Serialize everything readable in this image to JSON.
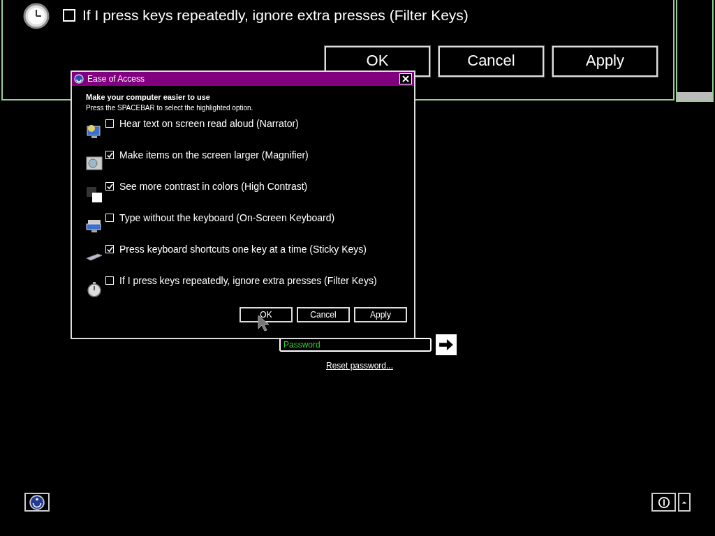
{
  "background_window": {
    "checkbox_label": "If I press keys repeatedly, ignore extra presses (Filter Keys)",
    "checked": false,
    "buttons": [
      "OK",
      "Cancel",
      "Apply"
    ]
  },
  "dialog": {
    "title": "Ease of Access",
    "heading": "Make your computer easier to use",
    "instruction": "Press the SPACEBAR to select the highlighted option.",
    "options": [
      {
        "kind": "narrator",
        "label": "Hear text on screen read aloud (Narrator)",
        "checked": false
      },
      {
        "kind": "magnifier",
        "label": "Make items on the screen larger (Magnifier)",
        "checked": true
      },
      {
        "kind": "contrast",
        "label": "See more contrast in colors (High Contrast)",
        "checked": true
      },
      {
        "kind": "keyboard",
        "label": "Type without the keyboard (On-Screen Keyboard)",
        "checked": false
      },
      {
        "kind": "sticky",
        "label": "Press keyboard shortcuts one key at a time (Sticky Keys)",
        "checked": true
      },
      {
        "kind": "filter",
        "label": "If I press keys repeatedly, ignore extra presses (Filter Keys)",
        "checked": false
      }
    ],
    "buttons": [
      "OK",
      "Cancel",
      "Apply"
    ]
  },
  "password": {
    "placeholder": "Password"
  },
  "reset_link": "Reset password..."
}
